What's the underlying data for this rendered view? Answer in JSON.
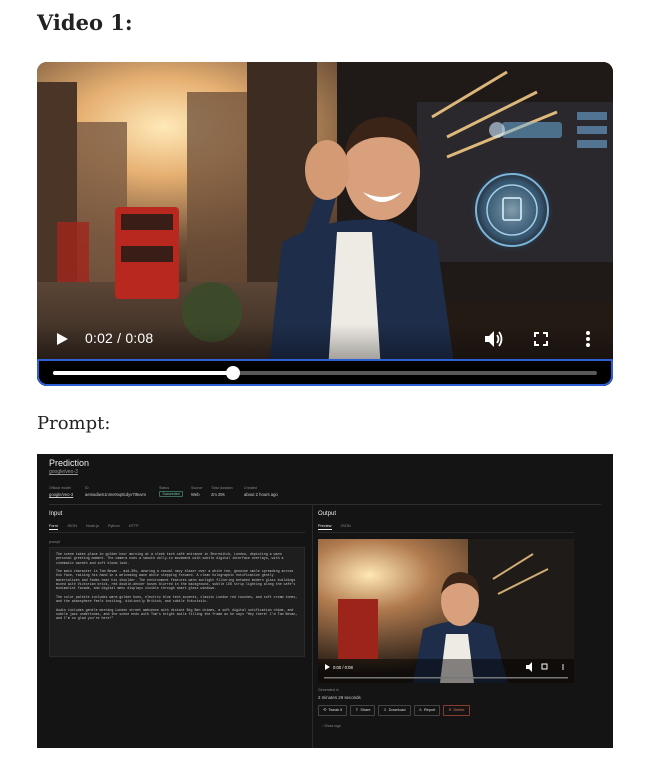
{
  "headings": {
    "video": "Video 1:",
    "prompt": "Prompt:"
  },
  "player": {
    "time_label": "0:02 / 0:08",
    "progress": 0.33,
    "icons": [
      "play-icon",
      "volume-icon",
      "fullscreen-icon",
      "more-vert-icon"
    ]
  },
  "prediction": {
    "title": "Prediction",
    "model_link": "google/veo-3",
    "meta": [
      {
        "label": "Official model",
        "value": "google/veo-3"
      },
      {
        "label": "ID",
        "value": "aemadiwn1nme0vq8cdyv7t9uvm"
      },
      {
        "label": "Status",
        "value": "Succeeded"
      },
      {
        "label": "Source",
        "value": "Web"
      },
      {
        "label": "Total duration",
        "value": "2m 29s"
      },
      {
        "label": "Created",
        "value": "about 2 hours ago"
      }
    ],
    "input": {
      "title": "Input",
      "tabs": [
        "Form",
        "JSON",
        "Node.js",
        "Python",
        "HTTP"
      ],
      "prompt_label": "prompt",
      "paragraphs": [
        "The scene takes place in golden hour morning at a sleek tech café entrance in Shoreditch, London, depicting a warm personal greeting moment. The camera uses a smooth dolly-in movement with subtle digital interface overlays, with a cinematic warmth and soft bloom look.",
        "The main character is Tom Bevan - mid-30s, wearing a casual navy blazer over a white tee, genuine smile spreading across his face, raising his hand in a welcoming wave while stepping forward. A clean holographic notification gently materializes and fades near his shoulder. The environment features warm sunlight filtering between modern glass buildings mixed with Victorian brick, red double-decker buses blurred in the background, subtle LED strip lighting along the café's minimalist facade, and digital menu displays visible through smart glass windows.",
        "The color palette includes warm golden hues, electric blue tech accents, classic London red touches, and soft cream tones, and the atmosphere feels inviting, distinctly British, and subtle futuristic.",
        "Audio includes gentle morning London street ambience with distant Big Ben chimes, a soft digital notification chime, and subtle jazz undertones, and the scene ends with Tom's bright smile filling the frame as he says \"Hey there! I'm Tom Bevan, and I'm so glad you're here!\""
      ]
    },
    "output": {
      "title": "Output",
      "tabs": [
        "Preview",
        "JSON"
      ],
      "time_label": "0:00 / 0:08",
      "generated_label": "Generated in",
      "generated_value": "2 minutes 29 seconds",
      "buttons": [
        "Tweak it",
        "Share",
        "Download",
        "Report",
        "Delete"
      ],
      "show_logs": "Show logs"
    }
  },
  "colors": {
    "accent_focus": "#2f5fd6",
    "delete": "#e07860",
    "succeeded": "#6fc7a3"
  }
}
